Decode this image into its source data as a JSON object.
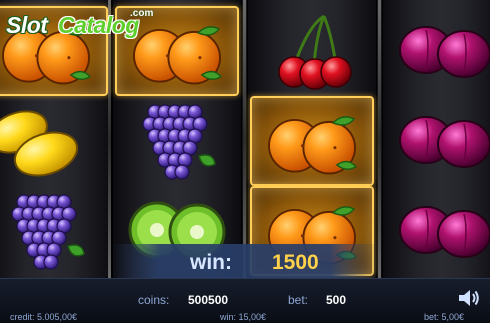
{
  "logo": {
    "slot": "Slot",
    "catalog": "Catalog",
    "com": ".com"
  },
  "reels": [
    [
      "orange",
      "lemon",
      "grapes"
    ],
    [
      "orange",
      "grapes",
      "kiwi"
    ],
    [
      "cherry",
      "orange",
      "orange"
    ],
    [
      "plum",
      "plum",
      "plum"
    ]
  ],
  "winning_cells": [
    [
      0,
      0
    ],
    [
      1,
      0
    ],
    [
      2,
      1
    ],
    [
      2,
      2
    ]
  ],
  "win": {
    "label": "win:",
    "amount": "1500"
  },
  "bottom": {
    "coins_label": "coins:",
    "coins_value": "500500",
    "bet_label": "bet:",
    "bet_value": "500",
    "credit": "credit: 5.005,00€",
    "win_small": "win: 15,00€",
    "bet_small": "bet: 5,00€"
  },
  "colors": {
    "win_amount": "#ffd24a",
    "highlight": "#ffcf5a",
    "logo_green": "#5fcf2e"
  },
  "icons": {
    "sound": "speaker-icon"
  }
}
